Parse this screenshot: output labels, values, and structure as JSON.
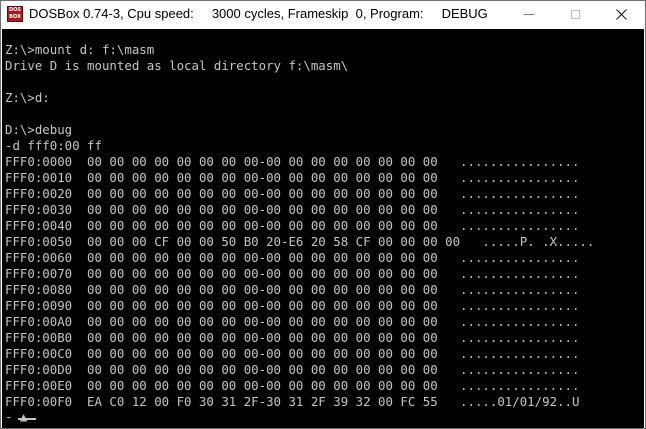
{
  "window": {
    "title": "DOSBox 0.74-3, Cpu speed:     3000 cycles, Frameskip  0, Program:     DEBUG",
    "icon": "dosbox-icon",
    "icon_text_top": "DOS",
    "icon_text_bottom": "BOX",
    "controls": {
      "minimize": "minimize-icon",
      "maximize": "maximize-icon",
      "close": "close-icon"
    }
  },
  "console": {
    "text_color": "#c4c4c4",
    "background": "#000000",
    "lines": [
      "",
      "Z:\\>mount d: f:\\masm",
      "Drive D is mounted as local directory f:\\masm\\",
      "",
      "Z:\\>d:",
      "",
      "D:\\>debug",
      "-d fff0:00 ff",
      "FFF0:0000  00 00 00 00 00 00 00 00-00 00 00 00 00 00 00 00   ................",
      "FFF0:0010  00 00 00 00 00 00 00 00-00 00 00 00 00 00 00 00   ................",
      "FFF0:0020  00 00 00 00 00 00 00 00-00 00 00 00 00 00 00 00   ................",
      "FFF0:0030  00 00 00 00 00 00 00 00-00 00 00 00 00 00 00 00   ................",
      "FFF0:0040  00 00 00 00 00 00 00 00-00 00 00 00 00 00 00 00   ................",
      "FFF0:0050  00 00 00 CF 00 00 50 B0 20-E6 20 58 CF 00 00 00 00   .....P. .X.....",
      "FFF0:0060  00 00 00 00 00 00 00 00-00 00 00 00 00 00 00 00   ................",
      "FFF0:0070  00 00 00 00 00 00 00 00-00 00 00 00 00 00 00 00   ................",
      "FFF0:0080  00 00 00 00 00 00 00 00-00 00 00 00 00 00 00 00   ................",
      "FFF0:0090  00 00 00 00 00 00 00 00-00 00 00 00 00 00 00 00   ................",
      "FFF0:00A0  00 00 00 00 00 00 00 00-00 00 00 00 00 00 00 00   ................",
      "FFF0:00B0  00 00 00 00 00 00 00 00-00 00 00 00 00 00 00 00   ................",
      "FFF0:00C0  00 00 00 00 00 00 00 00-00 00 00 00 00 00 00 00   ................",
      "FFF0:00D0  00 00 00 00 00 00 00 00-00 00 00 00 00 00 00 00   ................",
      "FFF0:00E0  00 00 00 00 00 00 00 00-00 00 00 00 00 00 00 00   ................",
      "FFF0:00F0  EA C0 12 00 F0 30 31 2F-30 31 2F 39 32 00 FC 55   .....01/01/92..U",
      "- ▲"
    ]
  }
}
